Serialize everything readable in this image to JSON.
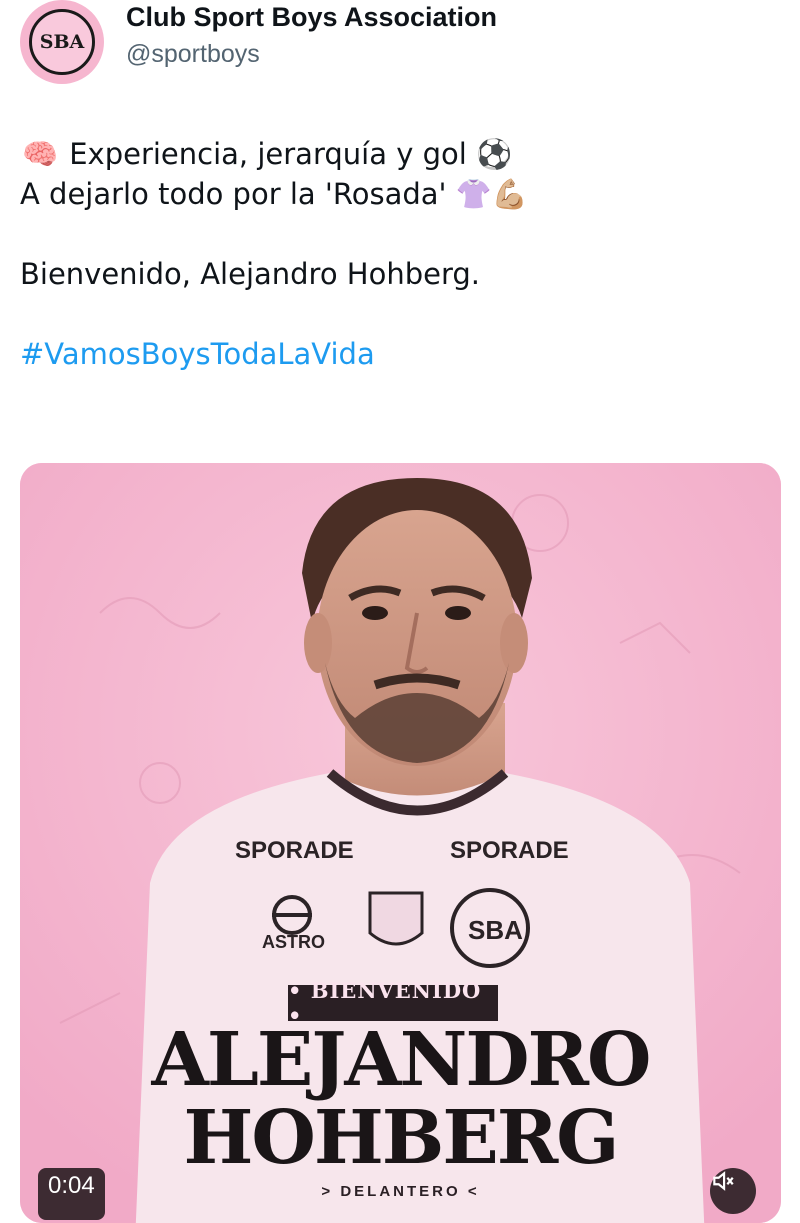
{
  "account": {
    "avatar_text": "SBA",
    "display_name": "Club Sport Boys Association",
    "handle": "@sportboys"
  },
  "tweet": {
    "line1_emoji": "🧠",
    "line1_text": "Experiencia, jerarquía y gol",
    "line1_trailing_emoji": "⚽",
    "line2_text": "A dejarlo todo por la 'Rosada'",
    "line2_emojis": "👚💪🏼",
    "line3_text": "Bienvenido, Alejandro Hohberg.",
    "hashtag": "#VamosBoysTodaLaVida"
  },
  "media": {
    "banner_label": "• BIENVENIDO •",
    "player_first_name": "ALEJANDRO",
    "player_last_name": "HOHBERG",
    "player_position": "> DELANTERO <",
    "sponsor_left": "SPORADE",
    "sponsor_right": "SPORADE",
    "sponsor_chest": "ASTRO",
    "crest_text": "SBA",
    "video_time": "0:04",
    "icons": {
      "mute": "speaker-muted-icon"
    },
    "colors": {
      "background": "#f5b9d1",
      "jersey": "#f7e6ec",
      "text": "#1a1517"
    }
  }
}
